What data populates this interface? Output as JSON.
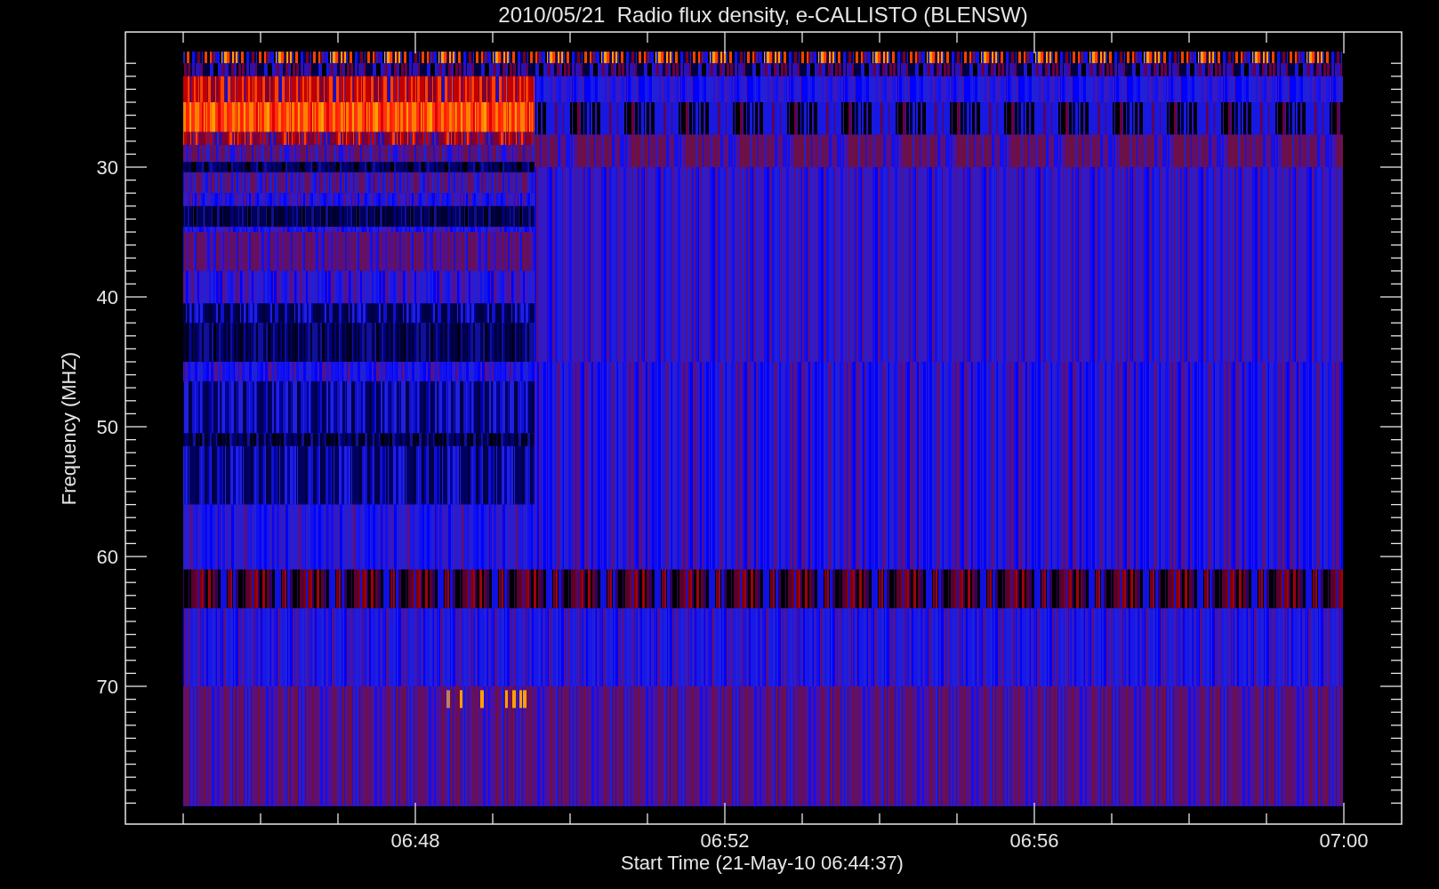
{
  "title": "2010/05/21  Radio flux density, e-CALLISTO (BLENSW)",
  "y_axis": {
    "label": "Frequency (MHZ)",
    "ticks": [
      "30",
      "40",
      "50",
      "60",
      "70"
    ]
  },
  "x_axis": {
    "label": "Start Time (21-May-10 06:44:37)",
    "ticks": [
      "06:48",
      "06:52",
      "06:56",
      "07:00"
    ]
  }
}
